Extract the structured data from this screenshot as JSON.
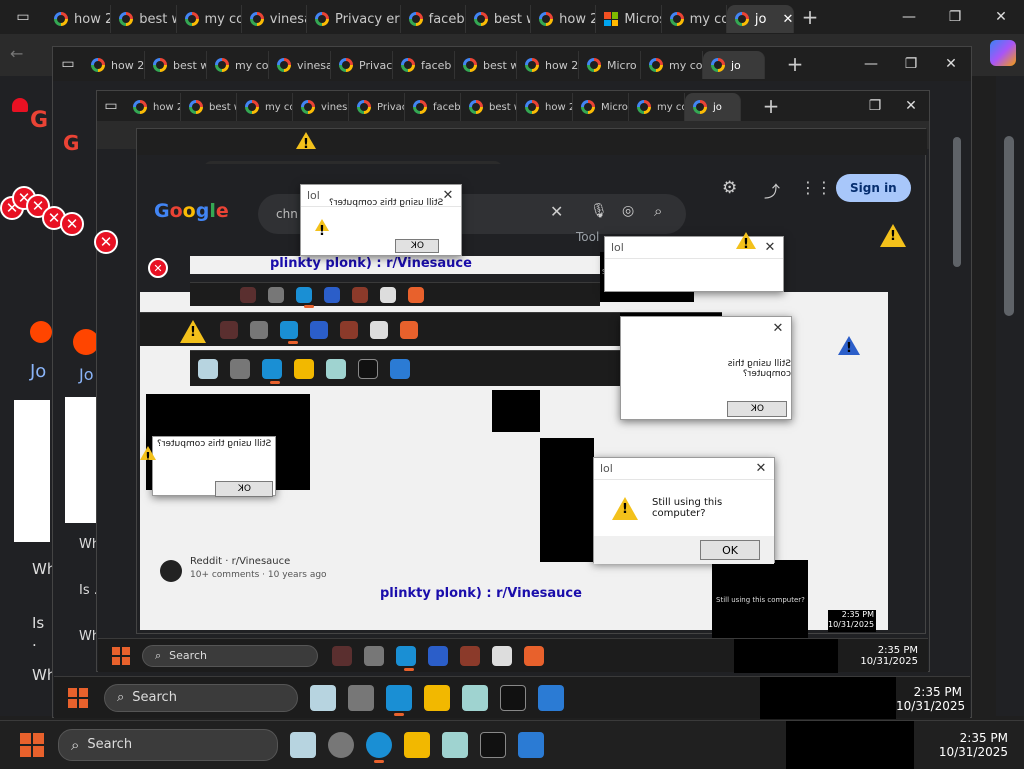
{
  "outer_tabs": [
    {
      "label": "how 2",
      "icon": "google"
    },
    {
      "label": "best w",
      "icon": "google"
    },
    {
      "label": "my co",
      "icon": "google"
    },
    {
      "label": "vinesa",
      "icon": "google"
    },
    {
      "label": "Privacy erro",
      "icon": "google"
    },
    {
      "label": "faceb",
      "icon": "google"
    },
    {
      "label": "best w",
      "icon": "google"
    },
    {
      "label": "how 2",
      "icon": "google"
    },
    {
      "label": "Micros",
      "icon": "microsoft"
    },
    {
      "label": "my co",
      "icon": "google"
    },
    {
      "label": "jo",
      "icon": "google",
      "active": true
    }
  ],
  "nested_tabs_2": [
    "how 2",
    "best w",
    "my co",
    "vinesa",
    "Privacy erro",
    "faceb",
    "best w",
    "how 2",
    "Micro",
    "my co",
    "jo"
  ],
  "nested_tabs_3": [
    "how 2",
    "best w",
    "my co",
    "vinesa",
    "Privacy erro",
    "faceb",
    "best w",
    "how 2",
    "Micro",
    "my co",
    "jo"
  ],
  "google_search": {
    "logo": "Google",
    "query_fragment": "chn",
    "signin_label": "Sign in",
    "filter_tab": "Tool"
  },
  "reddit_result": {
    "title_suffix": "plinkty plonk) : r/Vinesauce",
    "source": "Reddit · r/Vinesauce",
    "meta": "10+ comments · 10 years ago"
  },
  "page_snippets": {
    "jo": "Jo",
    "wh": "Wh",
    "is": "Is ."
  },
  "dialogs": {
    "title": "lol",
    "message": "Still using this computer?",
    "message_mirrored": "Still using this computer?",
    "ok_label": "OK"
  },
  "taskbar": {
    "search_label": "Search",
    "time": "2:35 PM",
    "date": "10/31/2025"
  },
  "colors": {
    "accent": "#e8612c",
    "warning": "#f3c11b",
    "error": "#e81123",
    "signin_bg": "#a8c7fa"
  }
}
